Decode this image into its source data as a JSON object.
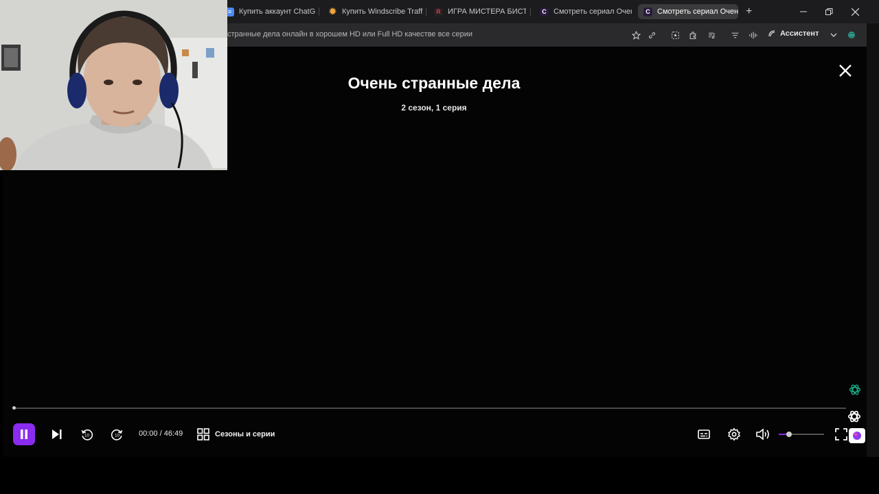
{
  "tabs": [
    {
      "label": "Купить аккаунт ChatGPT",
      "favicon": "doc-icon",
      "active": false
    },
    {
      "label": "Купить Windscribe Traffic",
      "favicon": "sun-icon",
      "active": false
    },
    {
      "label": "ИГРА МИСТЕРА БИСТА |",
      "favicon": "r-logo-icon",
      "active": false
    },
    {
      "label": "Смотреть сериал Очень",
      "favicon": "c-logo-icon",
      "active": false
    },
    {
      "label": "Смотреть сериал Очень",
      "favicon": "c-logo-icon",
      "active": true
    }
  ],
  "address_bar": {
    "url_text": "странные дела онлайн в хорошем HD или Full HD качестве все серии",
    "assistant_label": "Ассистент"
  },
  "player": {
    "title": "Очень странные дела",
    "subtitle": "2 сезон, 1 серия",
    "time": "00:00 / 46:49",
    "seasons_label": "Сезоны и серии",
    "progress_fraction": 0.0,
    "volume_fraction": 0.22,
    "accent_color": "#8a2bf0"
  }
}
